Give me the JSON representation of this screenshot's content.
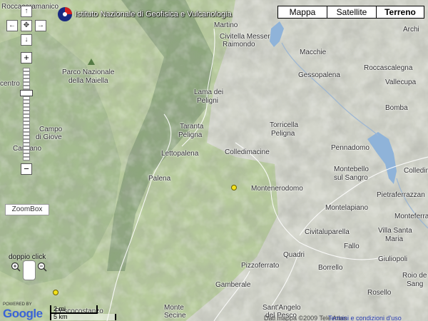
{
  "map": {
    "colors": {
      "terrain": "#cfd2c8",
      "green": "#b4c99a",
      "lake": "#8fb3d9"
    },
    "maptype": [
      "Mappa",
      "Satellite",
      "Terreno"
    ],
    "maptype_active": "Terreno",
    "overlay_title": "Istituto Nazionale di Geofisica e Vulcanologia",
    "zoombox_label": "ZoomBox",
    "doppio_click_label": "doppio click",
    "scale_top": "2 mi",
    "scale_bottom": "5 km",
    "google_logo": "Google",
    "powered_by": "POWERED BY",
    "copyright": "Dati mappa ©2009 Tele Atlas",
    "terms": "Termini e condizioni d'uso",
    "places": {
      "roccacaramanico": "Roccacaramanico",
      "martino": "Martino",
      "civitella": "Civitella Messer",
      "raimondo": "Raimondo",
      "archi": "Archi",
      "macchie": "Macchie",
      "gessopalena": "Gessopalena",
      "roccascalegna": "Roccascalegna",
      "vallecupa": "Vallecupa",
      "parco1": "Parco Nazionale",
      "parco2": "della Maiella",
      "centro": "centro",
      "lama1": "Lama dei",
      "lama2": "Peligni",
      "bomba": "Bomba",
      "campo1": "Campo",
      "campo2": "di Giove",
      "taranta1": "Taranta",
      "taranta2": "Peligna",
      "torricella1": "Torricella",
      "torricella2": "Peligna",
      "pennadomo": "Pennadomo",
      "cansano": "Cansano",
      "lettopalena": "Lettopalena",
      "colledimacine": "Colledimacine",
      "colledimezzo": "Colledimezzo",
      "montebello1": "Montebello",
      "montebello2": "sul Sangro",
      "palena": "Palena",
      "montenerodomo": "Montenerodomo",
      "pietraferrazzana": "Pietraferrazzan",
      "montelapiano": "Montelapiano",
      "monteferrante": "Monteferra",
      "civitaluparella": "Civitaluparella",
      "villasantamaria1": "Villa Santa",
      "villasantamaria2": "Maria",
      "quadri": "Quadri",
      "fallo": "Fallo",
      "giuliopoli": "Giuliopoli",
      "pizzoferrato": "Pizzoferrato",
      "borrello": "Borrello",
      "roiodelsangro1": "Roio de",
      "roiodelsangro2": "Sang",
      "gamberale": "Gamberale",
      "rosello": "Rosello",
      "pescocostanzo": "Pescocostanzo",
      "montesecine1": "Monte",
      "montesecine2": "Secine",
      "santangelo1": "Sant'Angelo",
      "santangelo2": "del Pesco"
    }
  }
}
